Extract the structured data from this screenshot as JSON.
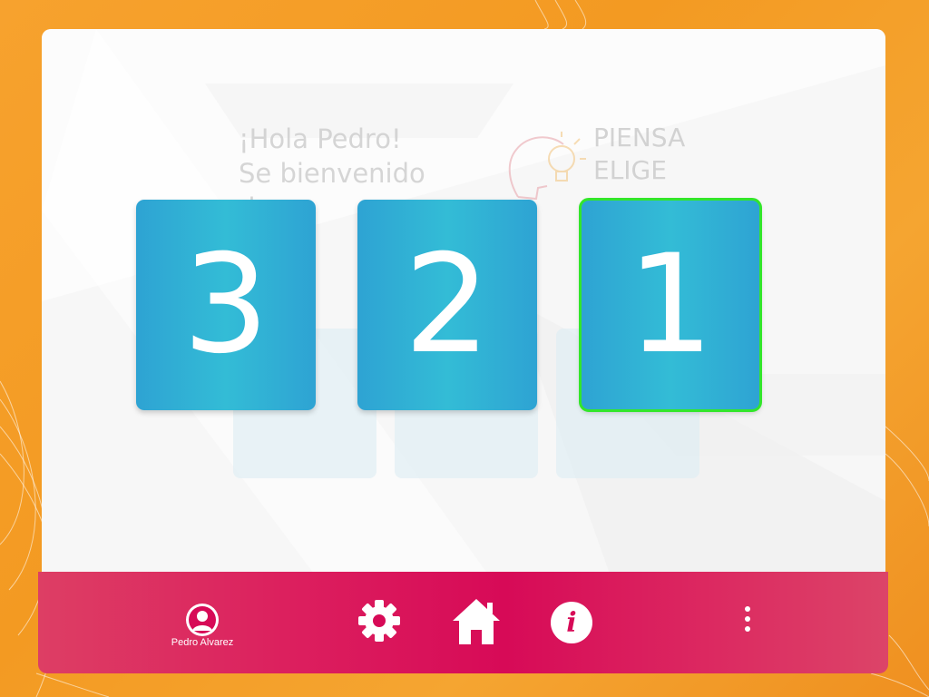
{
  "background": {
    "accent": "#f39a22"
  },
  "panel": {
    "ghost_greeting": [
      "¡Hola Pedro!",
      "Se bienvenido",
      "do"
    ],
    "ghost_think": [
      "PIENSA",
      "ELIGE"
    ]
  },
  "countdown": {
    "cards": [
      {
        "value": "3",
        "selected": false
      },
      {
        "value": "2",
        "selected": false
      },
      {
        "value": "1",
        "selected": true
      }
    ],
    "card_color": "#33bcd6",
    "selected_border_color": "#33e62b"
  },
  "bottom_bar": {
    "color": "#d70a57",
    "user": {
      "name": "Pedro Alvarez",
      "icon": "user-avatar-icon"
    },
    "buttons": [
      {
        "name": "settings",
        "icon": "gear-icon"
      },
      {
        "name": "home",
        "icon": "home-icon"
      },
      {
        "name": "info",
        "icon": "info-icon",
        "glyph": "i"
      },
      {
        "name": "more",
        "icon": "kebab-menu-icon"
      }
    ]
  }
}
